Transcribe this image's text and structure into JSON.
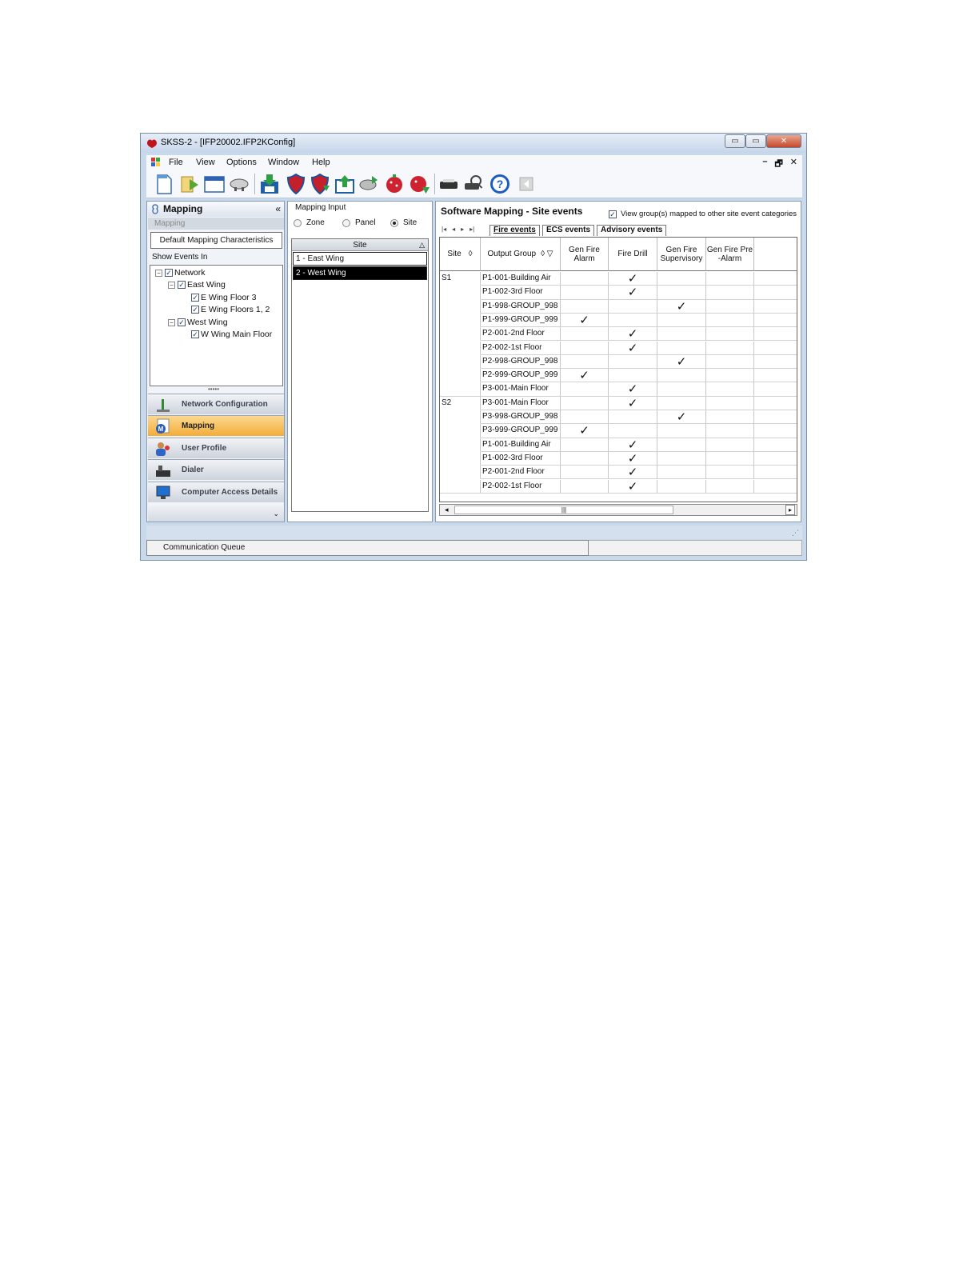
{
  "window": {
    "title": "SKSS-2 - [IFP20002.IFP2KConfig]",
    "caption_buttons": {
      "minimize": "▭",
      "maximize": "▭",
      "close": "✕"
    }
  },
  "menu": {
    "items": [
      "File",
      "View",
      "Options",
      "Window",
      "Help"
    ],
    "mdi": {
      "minimize": "–",
      "restore": "🗗",
      "close": "✕"
    }
  },
  "toolbar": {
    "buttons": [
      "new-document",
      "run",
      "window",
      "devices",
      "download",
      "shield-red",
      "shield-red-green",
      "upload",
      "network",
      "bug-red",
      "bug-red-green",
      "printer",
      "search-print",
      "help",
      "back"
    ]
  },
  "nav": {
    "header": "Mapping",
    "collapse": "«",
    "subheader": "Mapping",
    "default_button": "Default Mapping Characteristics",
    "show_events_label": "Show Events In",
    "tree": [
      {
        "label": "Network",
        "level": 0,
        "expander": "−",
        "checked": "✓"
      },
      {
        "label": "East Wing",
        "level": 1,
        "expander": "−",
        "checked": "✓"
      },
      {
        "label": "E Wing Floor 3",
        "level": 2,
        "checked": "✓"
      },
      {
        "label": "E Wing Floors 1, 2",
        "level": 2,
        "checked": "✓"
      },
      {
        "label": "West Wing",
        "level": 1,
        "expander": "−",
        "checked": "✓"
      },
      {
        "label": "W Wing Main Floor",
        "level": 2,
        "checked": "✓"
      }
    ],
    "grip": "•••••",
    "buttons": [
      {
        "label": "Network Configuration",
        "selected": false
      },
      {
        "label": "Mapping",
        "selected": true
      },
      {
        "label": "User Profile",
        "selected": false
      },
      {
        "label": "Dialer",
        "selected": false
      },
      {
        "label": "Computer Access Details",
        "selected": false
      }
    ],
    "footer_arrow": "⌄"
  },
  "mapping_input": {
    "legend": "Mapping Input",
    "options": [
      {
        "label": "Zone",
        "selected": false
      },
      {
        "label": "Panel",
        "selected": false
      },
      {
        "label": "Site",
        "selected": true
      }
    ],
    "list_header": "Site",
    "sort_indicator": "△",
    "sites": [
      {
        "label": "1 - East Wing",
        "selected": false
      },
      {
        "label": "2 - West Wing",
        "selected": true
      }
    ]
  },
  "software_mapping": {
    "title": "Software Mapping - Site events",
    "view_groups_label": "View group(s) mapped to other site event categories",
    "view_groups_checked": "✓",
    "nav_arrows": [
      "|◂",
      "◂",
      "▸",
      "▸|"
    ],
    "tabs": [
      {
        "label": "Fire events",
        "active": true
      },
      {
        "label": "ECS events",
        "active": false
      },
      {
        "label": "Advisory events",
        "active": false
      }
    ],
    "columns": [
      {
        "label": "Site",
        "icon": "◊"
      },
      {
        "label": "Output Group",
        "icon": "◊ ▽"
      },
      {
        "label": "Gen Fire Alarm"
      },
      {
        "label": "Fire Drill"
      },
      {
        "label": "Gen Fire Supervisory"
      },
      {
        "label": "Gen Fire Pre -Alarm"
      }
    ],
    "check_mark": "✓",
    "rows": [
      {
        "site": "S1",
        "group": "P1-001-Building Air",
        "marks": [
          false,
          true,
          false,
          false
        ]
      },
      {
        "site": "",
        "group": "P1-002-3rd Floor",
        "marks": [
          false,
          true,
          false,
          false
        ]
      },
      {
        "site": "",
        "group": "P1-998-GROUP_998",
        "marks": [
          false,
          false,
          true,
          false
        ]
      },
      {
        "site": "",
        "group": "P1-999-GROUP_999",
        "marks": [
          true,
          false,
          false,
          false
        ]
      },
      {
        "site": "",
        "group": "P2-001-2nd Floor",
        "marks": [
          false,
          true,
          false,
          false
        ]
      },
      {
        "site": "",
        "group": "P2-002-1st Floor",
        "marks": [
          false,
          true,
          false,
          false
        ]
      },
      {
        "site": "",
        "group": "P2-998-GROUP_998",
        "marks": [
          false,
          false,
          true,
          false
        ]
      },
      {
        "site": "",
        "group": "P2-999-GROUP_999",
        "marks": [
          true,
          false,
          false,
          false
        ]
      },
      {
        "site": "",
        "group": "P3-001-Main Floor",
        "marks": [
          false,
          true,
          false,
          false
        ]
      },
      {
        "site": "S2",
        "group": "P3-001-Main Floor",
        "marks": [
          false,
          true,
          false,
          false
        ]
      },
      {
        "site": "",
        "group": "P3-998-GROUP_998",
        "marks": [
          false,
          false,
          true,
          false
        ]
      },
      {
        "site": "",
        "group": "P3-999-GROUP_999",
        "marks": [
          true,
          false,
          false,
          false
        ]
      },
      {
        "site": "",
        "group": "P1-001-Building Air",
        "marks": [
          false,
          true,
          false,
          false
        ]
      },
      {
        "site": "",
        "group": "P1-002-3rd Floor",
        "marks": [
          false,
          true,
          false,
          false
        ]
      },
      {
        "site": "",
        "group": "P2-001-2nd Floor",
        "marks": [
          false,
          true,
          false,
          false
        ]
      },
      {
        "site": "",
        "group": "P2-002-1st Floor",
        "marks": [
          false,
          true,
          false,
          false
        ]
      }
    ],
    "scrollbar": {
      "left": "◂",
      "thumb": "|||",
      "right": "▸"
    }
  },
  "status": {
    "communication_queue": "Communication Queue",
    "resize_grip": "⋰"
  }
}
